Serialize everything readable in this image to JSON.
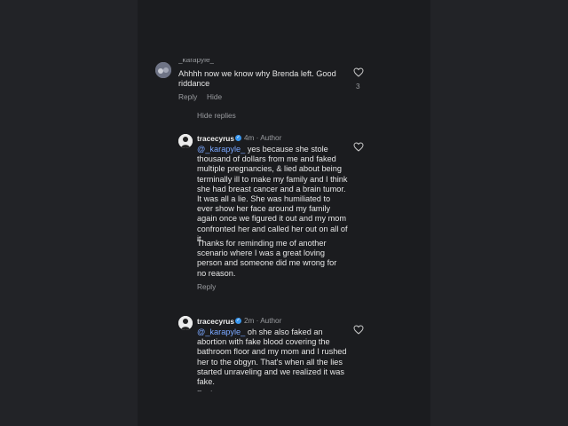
{
  "comment_top": {
    "username_cut": "_karapyle_",
    "text": "Ahhhh now we know why Brenda left. Good riddance",
    "likes": "3",
    "reply_label": "Reply",
    "hide_label": "Hide",
    "hide_replies_label": "Hide replies"
  },
  "reply1": {
    "username": "tracecyrus",
    "time": "4m",
    "author_tag": "Author",
    "mention": "@_karapyle_",
    "text1": " yes because she stole thousand of dollars from me and faked multiple pregnancies, & lied about being terminally ill  to make my family and I think she had breast cancer and a brain tumor. It was all a lie. She was humiliated to ever show her face around my family again once we figured it out and my mom confronted her and called her out on all of it.",
    "text2": "Thanks for reminding me of another scenario where I was a great loving person and someone did me wrong for no reason.",
    "reply_label": "Reply"
  },
  "reply2": {
    "username": "tracecyrus",
    "time": "2m",
    "author_tag": "Author",
    "mention": "@_karapyle_",
    "text1": " oh she also faked an abortion with fake blood covering the bathroom floor and my mom and I rushed her to the obgyn. That's when all the lies started unraveling and we realized it was fake.",
    "reply_label": "Reply"
  },
  "colors": {
    "background": "#1b1c1f",
    "text": "#e6e6e6",
    "muted": "#9a9ca0",
    "mention": "#7aa7ff",
    "verified": "#3897f0"
  }
}
